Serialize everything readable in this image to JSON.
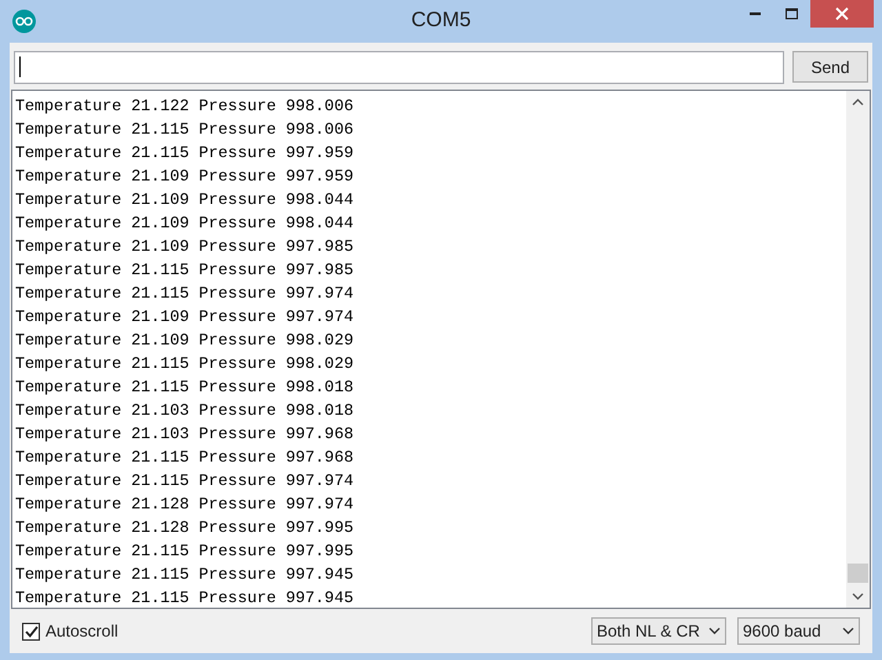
{
  "window": {
    "title": "COM5"
  },
  "send_button": "Send",
  "output_lines": [
    "Temperature 21.122 Pressure 998.006",
    "Temperature 21.115 Pressure 998.006",
    "Temperature 21.115 Pressure 997.959",
    "Temperature 21.109 Pressure 997.959",
    "Temperature 21.109 Pressure 998.044",
    "Temperature 21.109 Pressure 998.044",
    "Temperature 21.109 Pressure 997.985",
    "Temperature 21.115 Pressure 997.985",
    "Temperature 21.115 Pressure 997.974",
    "Temperature 21.109 Pressure 997.974",
    "Temperature 21.109 Pressure 998.029",
    "Temperature 21.115 Pressure 998.029",
    "Temperature 21.115 Pressure 998.018",
    "Temperature 21.103 Pressure 998.018",
    "Temperature 21.103 Pressure 997.968",
    "Temperature 21.115 Pressure 997.968",
    "Temperature 21.115 Pressure 997.974",
    "Temperature 21.128 Pressure 997.974",
    "Temperature 21.128 Pressure 997.995",
    "Temperature 21.115 Pressure 997.995",
    "Temperature 21.115 Pressure 997.945",
    "Temperature 21.115 Pressure 997.945"
  ],
  "autoscroll": {
    "label": "Autoscroll",
    "checked": true
  },
  "line_ending": {
    "value": "Both NL & CR"
  },
  "baud_rate": {
    "value": "9600 baud"
  }
}
